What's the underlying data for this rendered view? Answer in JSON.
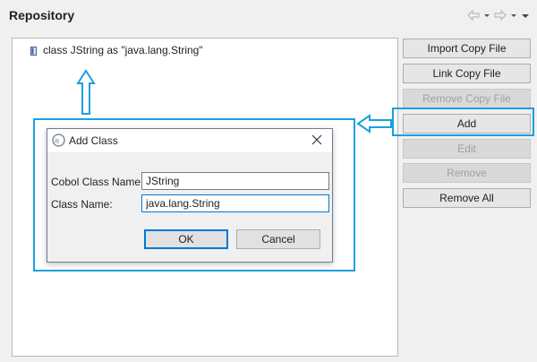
{
  "panel": {
    "title": "Repository"
  },
  "tree": {
    "items": [
      {
        "label": "class JString as \"java.lang.String\""
      }
    ]
  },
  "buttons": {
    "import_copy_file": "Import Copy File",
    "link_copy_file": "Link Copy File",
    "remove_copy_file": "Remove Copy File",
    "add": "Add",
    "edit": "Edit",
    "remove": "Remove",
    "remove_all": "Remove All"
  },
  "dialog": {
    "title": "Add Class",
    "cobol_class_name_label": "Cobol Class Name:",
    "cobol_class_name_value": "JString",
    "class_name_label": "Class Name:",
    "class_name_value": "java.lang.String",
    "ok_label": "OK",
    "cancel_label": "Cancel"
  },
  "colors": {
    "highlight": "#1ba0e0",
    "default_button_border": "#0078d7"
  },
  "icons": {
    "back": "arrow-left-icon",
    "forward": "arrow-right-icon",
    "menu": "chevron-down-icon",
    "close": "close-icon",
    "file": "file-icon",
    "app_logo": "is-logo-icon"
  }
}
